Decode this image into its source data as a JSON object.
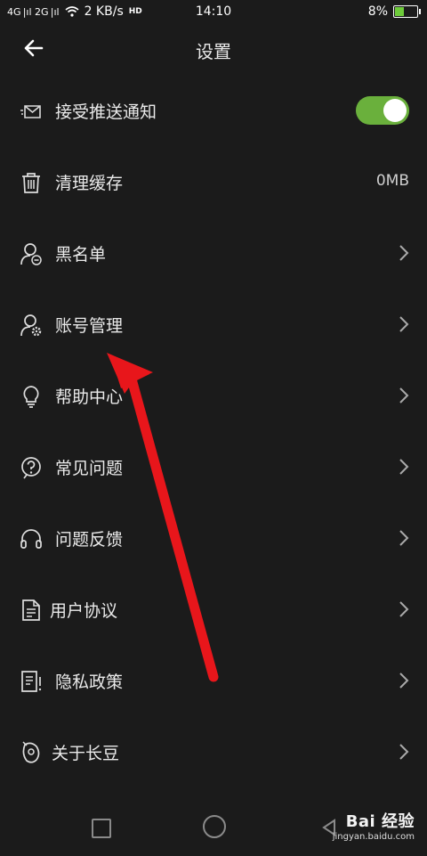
{
  "statusbar": {
    "signals": "4G |ıl 2G |ıl",
    "speed": "2 KB/s",
    "hd": "HD",
    "time": "14:10",
    "battery": "8%"
  },
  "header": {
    "title": "设置"
  },
  "items": [
    {
      "label": "接受推送通知",
      "icon": "message-icon",
      "control": "toggle",
      "toggle_on": true
    },
    {
      "label": "清理缓存",
      "icon": "trash-icon",
      "control": "value",
      "value": "0MB"
    },
    {
      "label": "黑名单",
      "icon": "user-block-icon",
      "control": "chevron"
    },
    {
      "label": "账号管理",
      "icon": "user-gear-icon",
      "control": "chevron"
    },
    {
      "label": "帮助中心",
      "icon": "lightbulb-icon",
      "control": "chevron"
    },
    {
      "label": "常见问题",
      "icon": "question-icon",
      "control": "chevron"
    },
    {
      "label": "问题反馈",
      "icon": "headphones-icon",
      "control": "chevron"
    },
    {
      "label": "用户协议",
      "icon": "document-icon",
      "control": "chevron"
    },
    {
      "label": "隐私政策",
      "icon": "policy-icon",
      "control": "chevron"
    },
    {
      "label": "关于长豆",
      "icon": "app-logo-icon",
      "control": "chevron"
    }
  ],
  "colors": {
    "background": "#1b1b1b",
    "toggle_on": "#6ab03c",
    "annotation_arrow": "#e8161b"
  },
  "watermark": {
    "logo": "Bai 经验",
    "site": "jingyan.baidu.com"
  }
}
